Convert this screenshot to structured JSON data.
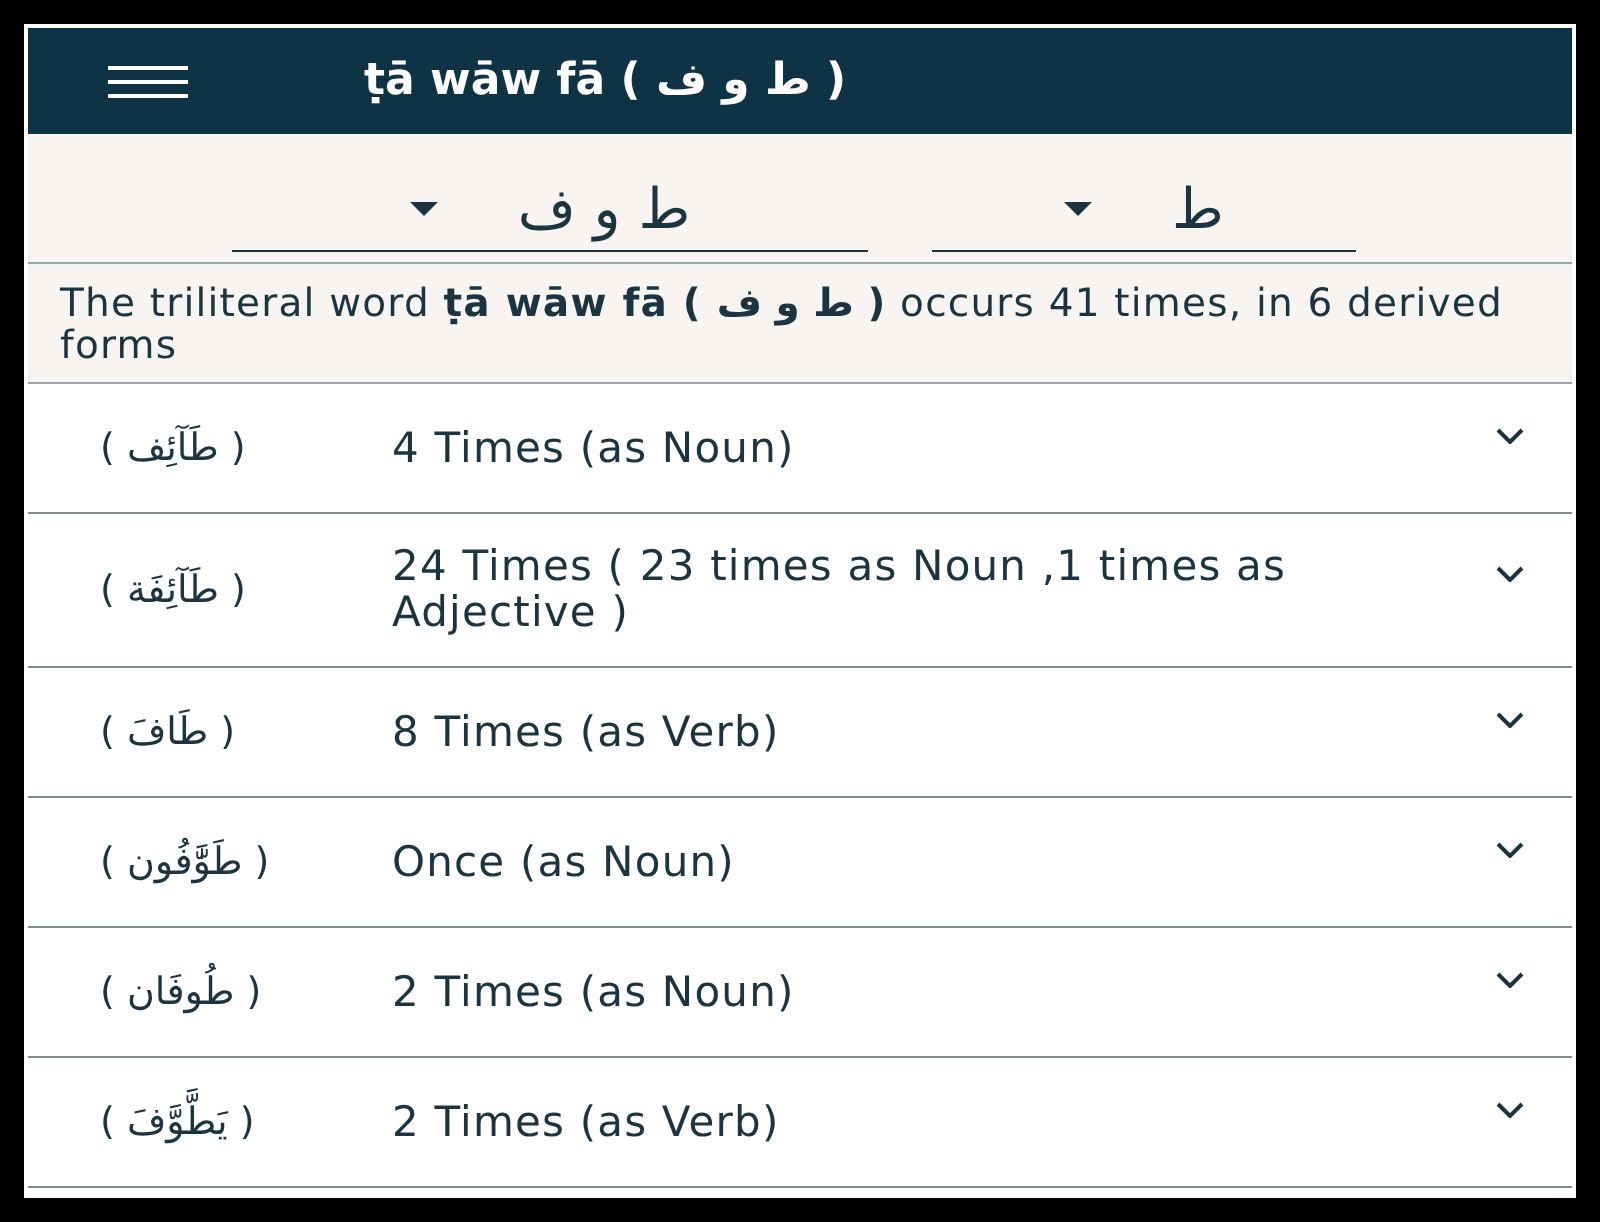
{
  "header": {
    "title": "ṭā wāw fā ( ط و ف )"
  },
  "dropdowns": [
    {
      "value": "ط"
    },
    {
      "value": "ط و ف"
    }
  ],
  "description": "The triliteral word **ṭā wāw fā ( ط و ف )** occurs 41 times, in 6 derived forms",
  "forms": [
    {
      "word": "( طَآئِف )",
      "text": "4 Times (as Noun)",
      "expanded": false
    },
    {
      "word": "( طَآئِفَة )",
      "text": "24 Times ( 23 times as Noun ,1 times as Adjective )",
      "expanded": false
    },
    {
      "word": "( طَافَ )",
      "text": "8 Times (as Verb)",
      "expanded": false
    },
    {
      "word": "( طَوَّٰفُون )",
      "text": "Once (as Noun)",
      "expanded": false
    },
    {
      "word": "( طُوفَان )",
      "text": "2 Times (as Noun)",
      "expanded": false
    },
    {
      "word": "( يَطَّوَّفَ )",
      "text": "2 Times (as Verb)",
      "expanded": false
    }
  ]
}
